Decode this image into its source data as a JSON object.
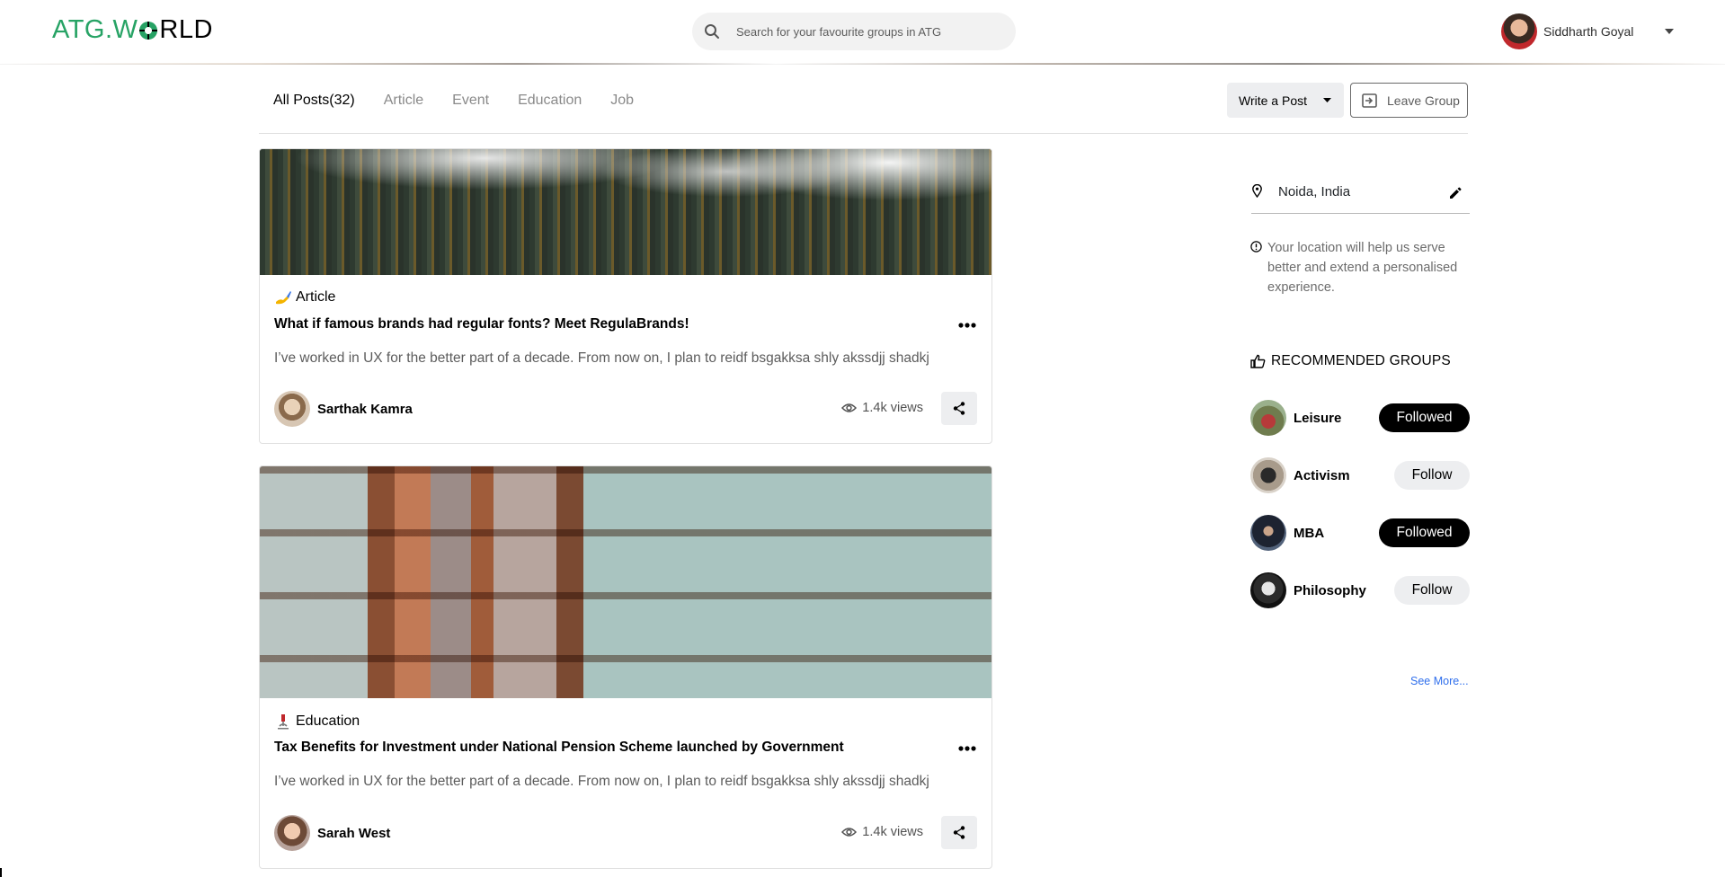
{
  "header": {
    "logo_part1": "ATG.W",
    "logo_part2": "RLD",
    "search_placeholder": "Search for your favourite groups in ATG",
    "user_name": "Siddharth Goyal"
  },
  "tabs": [
    {
      "label": "All Posts(32)",
      "active": true
    },
    {
      "label": "Article"
    },
    {
      "label": "Event"
    },
    {
      "label": "Education"
    },
    {
      "label": "Job"
    }
  ],
  "actions": {
    "write_post": "Write a Post",
    "leave_group": "Leave Group"
  },
  "posts": [
    {
      "category": "Article",
      "category_icon": "writing-hand-icon",
      "title": "What if famous brands had regular fonts? Meet RegulaBrands!",
      "excerpt": "I’ve worked in UX for the better part of a decade. From now on, I plan to reidf bsgakksa shly akssdjj shadkj",
      "author": "Sarthak Kamra",
      "views": "1.4k views"
    },
    {
      "category": "Education",
      "category_icon": "microscope-icon",
      "title": "Tax Benefits for Investment under National Pension Scheme launched by Government",
      "excerpt": "I’ve worked in UX for the better part of a decade. From now on, I plan to reidf bsgakksa shly akssdjj shadkj",
      "author": "Sarah West",
      "views": "1.4k views"
    }
  ],
  "sidebar": {
    "location": "Noida, India",
    "location_info": "Your location will help us serve better and extend a personalised experience.",
    "recommended_heading": "RECOMMENDED GROUPS",
    "groups": [
      {
        "name": "Leisure",
        "button": "Followed"
      },
      {
        "name": "Activism",
        "button": "Follow"
      },
      {
        "name": "MBA",
        "button": "Followed"
      },
      {
        "name": "Philosophy",
        "button": "Follow"
      }
    ],
    "see_more": "See More..."
  },
  "colors": {
    "brand_green": "#27a365",
    "link_blue": "#2f6fec",
    "followed_bg": "#000000",
    "follow_bg": "#edeef0"
  }
}
